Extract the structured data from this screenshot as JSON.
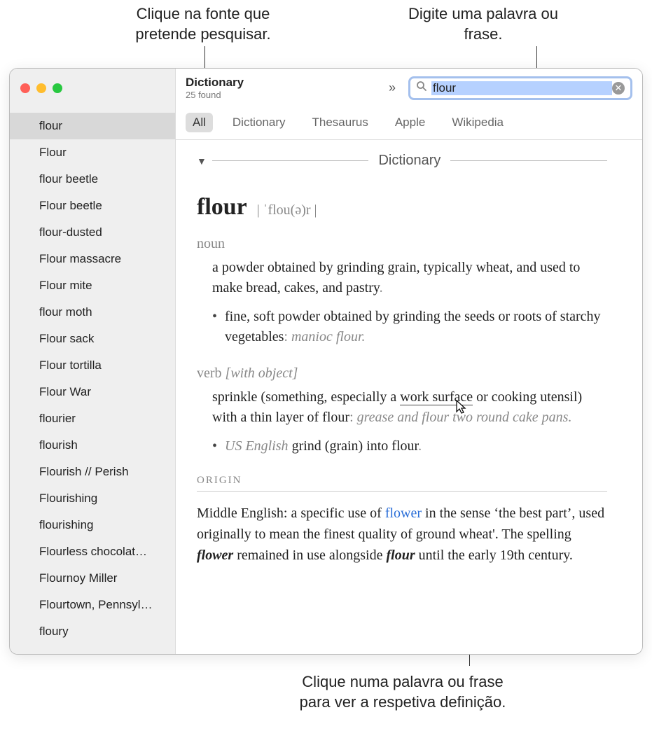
{
  "callouts": {
    "topLeft": "Clique na fonte que pretende pesquisar.",
    "topRight": "Digite uma palavra ou frase.",
    "bottom": "Clique numa palavra ou frase para ver a respetiva definição."
  },
  "app": {
    "title": "Dictionary",
    "subtitle": "25 found"
  },
  "search": {
    "value": "flour"
  },
  "tabs": [
    "All",
    "Dictionary",
    "Thesaurus",
    "Apple",
    "Wikipedia"
  ],
  "sidebar": {
    "items": [
      "flour",
      "Flour",
      "flour beetle",
      "Flour beetle",
      "flour-dusted",
      "Flour massacre",
      "Flour mite",
      "flour moth",
      "Flour sack",
      "Flour tortilla",
      "Flour War",
      "flourier",
      "flourish",
      "Flourish // Perish",
      "Flourishing",
      "flourishing",
      "Flourless chocolat…",
      "Flournoy Miller",
      "Flourtown, Pennsyl…",
      "floury"
    ]
  },
  "sectionLabel": "Dictionary",
  "entry": {
    "word": "flour",
    "pron": "| ˈflou(ə)r |",
    "noun": {
      "label": "noun",
      "def1": "a powder obtained by grinding grain, typically wheat, and used to make bread, cakes, and pastry",
      "def2a": "fine, soft powder obtained by grinding the seeds or roots of starchy vegetables",
      "def2b": "manioc flour."
    },
    "verb": {
      "label": "verb",
      "note": "[with object]",
      "def1a": "sprinkle (something, especially a ",
      "def1link": "work surface",
      "def1b": " or cooking utensil) with a thin layer of flour",
      "def1ex": "grease and flour two round cake pans.",
      "def2us": "US English",
      "def2": " grind (grain) into flour"
    },
    "originHead": "ORIGIN",
    "origin": {
      "t1": "Middle English: a specific use of ",
      "flower": "flower",
      "t2": " in the sense ‘the best part’, used originally to mean the finest quality of ground wheat'. The spelling ",
      "em1": "flower",
      "t3": " remained in use alongside ",
      "em2": "flour",
      "t4": " until the early 19th century."
    }
  }
}
